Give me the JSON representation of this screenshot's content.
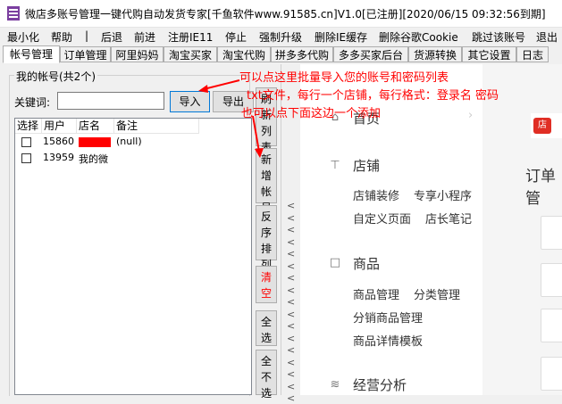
{
  "window": {
    "title": "微店多账号管理一键代购自动发货专家[千鱼软件www.91585.cn]V1.0[已注册][2020/06/15 09:32:56到期]"
  },
  "menu": [
    "最小化",
    "帮助",
    "|",
    "后退",
    "前进",
    "注册IE11",
    "停止",
    "强制升级",
    "删除IE缓存",
    "删除谷歌Cookie",
    "跳过该账号",
    "退出"
  ],
  "tabs": [
    "帐号管理",
    "订单管理",
    "阿里妈妈",
    "淘宝买家",
    "淘宝代购",
    "拼多多代购",
    "多多买家后台",
    "货源转换",
    "其它设置",
    "日志"
  ],
  "accounts_panel": {
    "group_title": "我的帐号(共2个)",
    "keyword_label": "关键词:",
    "keyword_value": "",
    "import_label": "导入",
    "export_label": "导出",
    "columns": [
      "选择",
      "用户",
      "店名",
      "备注"
    ],
    "rows": [
      {
        "user": "15860",
        "shop": "",
        "remark": "(null)"
      },
      {
        "user": "13959",
        "shop": "我的微",
        "remark": ""
      }
    ]
  },
  "side_buttons": {
    "refresh": [
      "刷",
      "新",
      "列",
      "表"
    ],
    "add": [
      "新",
      "增",
      "帐",
      "号"
    ],
    "reverse": [
      "反",
      "序",
      "排",
      "列"
    ],
    "clear": [
      "清",
      "空"
    ],
    "select_all": [
      "全",
      "选"
    ],
    "select_none": [
      "全",
      "不",
      "选"
    ]
  },
  "chevron_glyph": "<",
  "store_nav": {
    "home": "首页",
    "shop": "店铺",
    "shop_items": [
      "店铺装修",
      "专享小程序",
      "自定义页面",
      "店长笔记"
    ],
    "goods": "商品",
    "goods_items": [
      "商品管理",
      "分类管理",
      "分销商品管理",
      "商品详情模板"
    ],
    "analytics": "经营分析",
    "order_title": "订单管",
    "shop_badge": "店"
  },
  "annotation": {
    "line1": "可以点这里批量导入您的账号和密码列表",
    "line2": "txt文件，每行一个店铺，每行格式：登录名 密码",
    "line3": "也可以点下面这边一个添加"
  },
  "colors": {
    "annotation": "#ff0000",
    "clear_button_text": "#ff0000",
    "redaction": "#ff0000"
  }
}
